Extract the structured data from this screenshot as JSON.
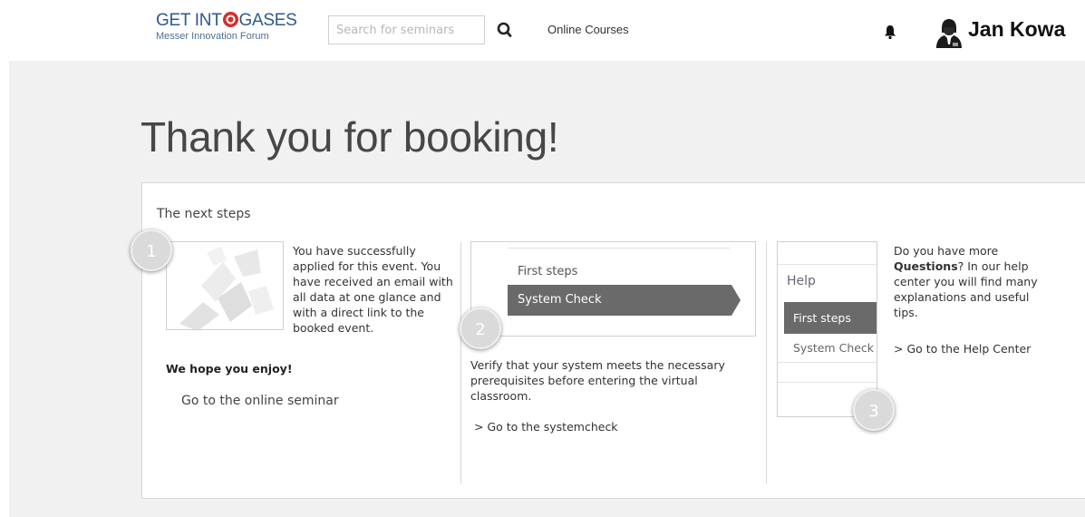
{
  "header": {
    "logo": {
      "line1_a": "GET INT",
      "line1_b": "GASES",
      "line2": "Messer Innovation Forum"
    },
    "search": {
      "placeholder": "Search for seminars",
      "value": ""
    },
    "search_icon": "search-icon",
    "nav": {
      "online_courses": "Online Courses"
    },
    "notification_icon": "bell-icon",
    "user": {
      "icon": "user-avatar-icon",
      "name": "Jan Kowa"
    }
  },
  "page": {
    "title": "Thank you for booking!",
    "panel_title": "The next steps"
  },
  "steps": [
    {
      "badge": "1",
      "text": "You have successfully applied for this event. You have received an email with all data at one glance and with a direct link to the booked event.",
      "enjoy": "We hope you enjoy!",
      "link": "Go to the online seminar"
    },
    {
      "badge": "2",
      "mock": {
        "first": "First steps",
        "active": "System Check"
      },
      "text": "Verify that your system meets the necessary prerequisites before entering the virtual classroom.",
      "link": "> Go to the systemcheck"
    },
    {
      "badge": "3",
      "mock": {
        "help": "Help",
        "active": "First steps",
        "second": "System Check"
      },
      "text_pre": "Do you have more ",
      "text_bold": "Questions",
      "text_post": "? In our help center you will find many explanations and useful tips.",
      "link": "> Go to the Help Center"
    }
  ],
  "colors": {
    "logo_blue": "#2c5a8e",
    "logo_target_red": "#d43030",
    "page_background": "#f1f1f1",
    "active_item": "#6a6a6a",
    "badge": "#dadada"
  }
}
